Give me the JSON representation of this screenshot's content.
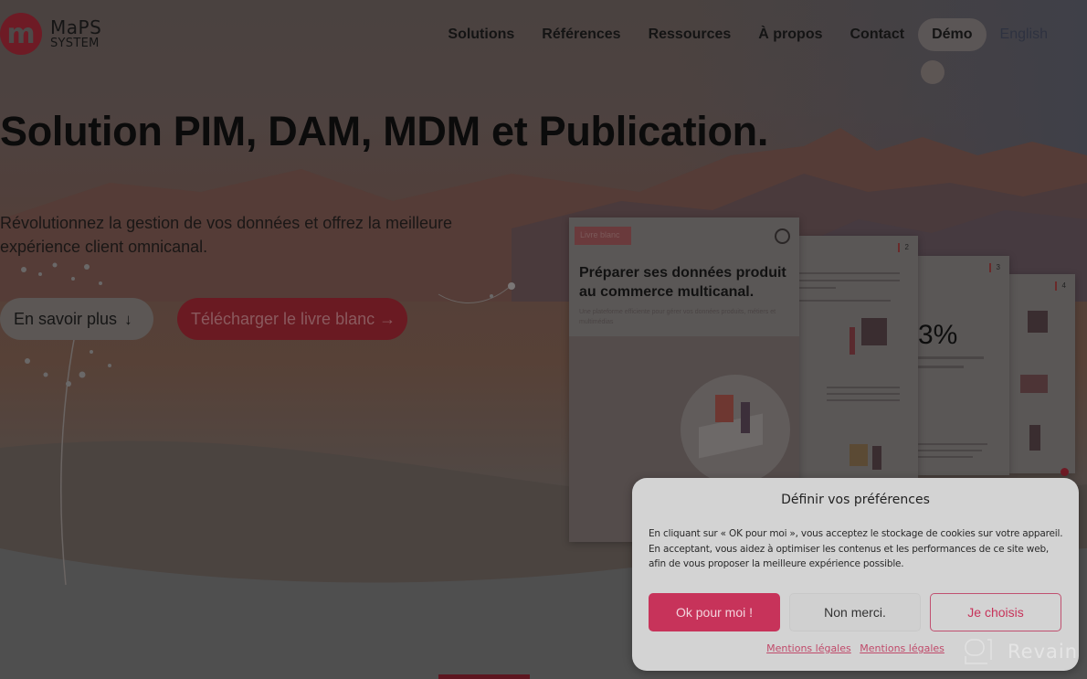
{
  "brand": {
    "logo_letter": "m",
    "name_line1": "MaPS",
    "name_line2": "SYSTEM"
  },
  "nav": {
    "items": [
      {
        "label": "Solutions"
      },
      {
        "label": "Références"
      },
      {
        "label": "Ressources"
      },
      {
        "label": "À propos"
      },
      {
        "label": "Contact"
      }
    ],
    "demo_label": "Démo",
    "language_label": "English"
  },
  "hero": {
    "title": "Solution PIM, DAM, MDM et Publication.",
    "subtitle": "Révolutionnez la gestion de vos données et offrez la meilleure expérience client omnicanal.",
    "learn_more_label": "En savoir plus",
    "learn_more_icon": "arrow-down-icon",
    "download_label": "Télécharger le livre blanc",
    "download_icon": "arrow-right-icon"
  },
  "whitepaper": {
    "ribbon": "Livre blanc",
    "title": "Préparer ses données produit au commerce multicanal.",
    "description": "Une plateforme efficiente pour gérer vos données produits, métiers et multimédias",
    "page_numbers": [
      "2",
      "3",
      "4"
    ],
    "stat": "3%"
  },
  "cookie": {
    "title": "Définir vos préférences",
    "text": "En cliquant sur « OK pour moi », vous acceptez le stockage de cookies sur votre appareil. En acceptant, vous aidez à optimiser les contenus et les performances de ce site web, afin de vous proposer la meilleure expérience possible.",
    "accept_label": "Ok pour moi !",
    "decline_label": "Non merci.",
    "choose_label": "Je choisis",
    "links": [
      "Mentions légales",
      "Mentions légales"
    ]
  },
  "watermark": {
    "text": "Revain"
  },
  "colors": {
    "accent": "#c7335a",
    "brand_red": "#6e1b25"
  }
}
